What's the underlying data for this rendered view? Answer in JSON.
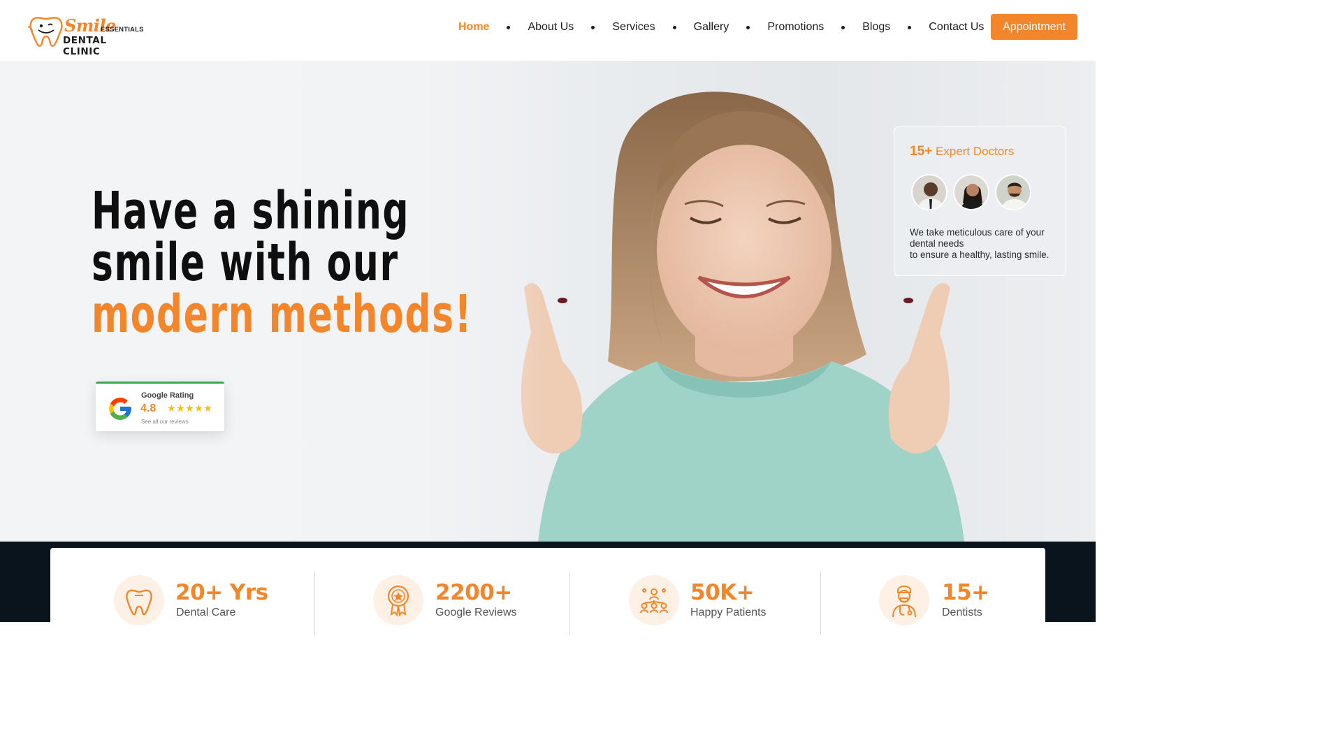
{
  "brand": {
    "name_script": "Smile",
    "name_small": "ESSENTIALS",
    "name_sub": "DENTAL CLINIC",
    "accent_color": "#f3862a",
    "logo_icon": "tooth-icon"
  },
  "nav": {
    "items": [
      {
        "label": "Home",
        "active": true
      },
      {
        "label": "About Us"
      },
      {
        "label": "Services"
      },
      {
        "label": "Gallery"
      },
      {
        "label": "Promotions"
      },
      {
        "label": "Blogs"
      },
      {
        "label": "Contact Us"
      }
    ],
    "cta_label": "Appointment"
  },
  "hero": {
    "title_line1": "Have a shining",
    "title_line2": "smile with our",
    "title_line3": "modern methods!"
  },
  "google_rating": {
    "label": "Google Rating",
    "value": "4.8",
    "stars": "★★★★★",
    "link_text": "See all our reviews"
  },
  "doctors": {
    "count": "15+",
    "title": "Expert Doctors",
    "description_line1": "We take meticulous care of your dental needs",
    "description_line2": "to ensure a healthy, lasting smile."
  },
  "stats": [
    {
      "value": "20+ Yrs",
      "label": "Dental Care",
      "icon": "tooth-icon"
    },
    {
      "value": "2200+",
      "label": "Google Reviews",
      "icon": "award-badge-icon"
    },
    {
      "value": "50K+",
      "label": "Happy Patients",
      "icon": "people-network-icon"
    },
    {
      "value": "15+",
      "label": "Dentists",
      "icon": "doctor-icon"
    }
  ]
}
